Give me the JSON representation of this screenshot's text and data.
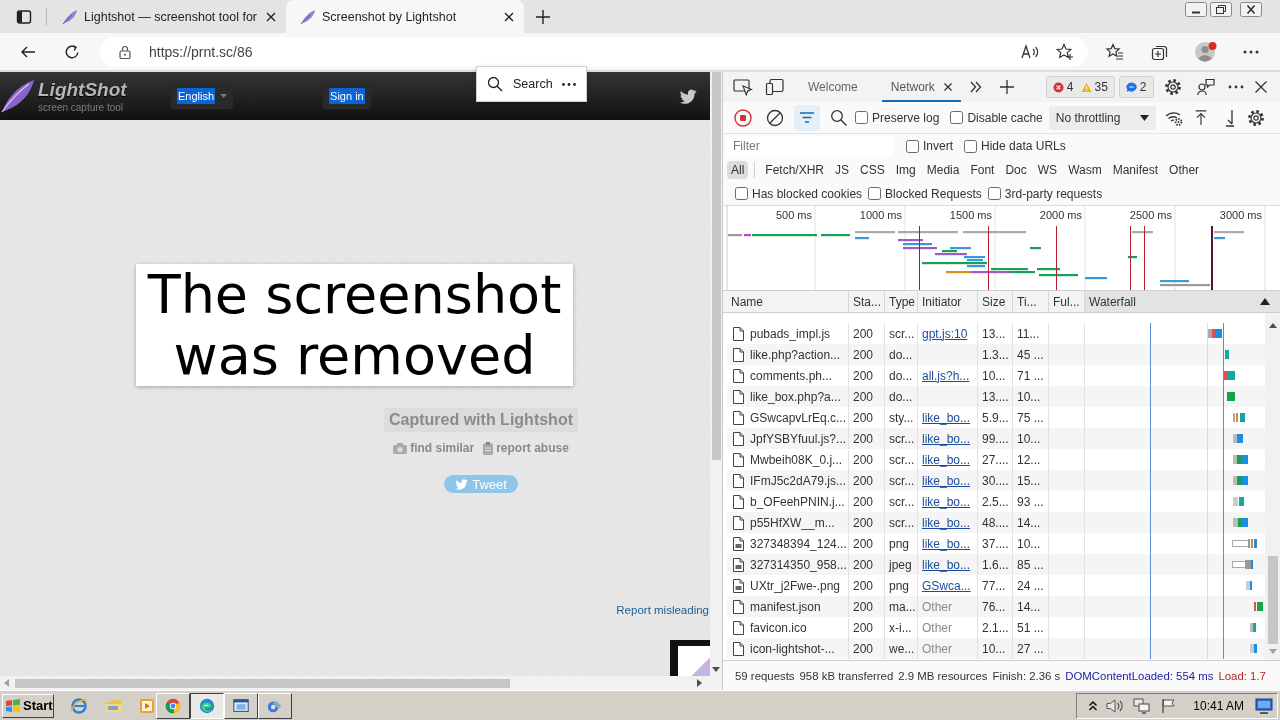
{
  "browser": {
    "tabs": [
      {
        "title": "Lightshot — screenshot tool for",
        "selected": false
      },
      {
        "title": "Screenshot by Lightshot",
        "selected": true
      }
    ],
    "url": "https://prnt.sc/86"
  },
  "page": {
    "header": {
      "logo_title": "LightShot",
      "logo_tagline": "screen capture tool",
      "language_button": "English",
      "sign_in_button": "Sign in"
    },
    "search_popup": {
      "label": "Search"
    },
    "notice": "The screenshot was removed",
    "captured_label": "Captured with Lightshot",
    "links": [
      {
        "label": "find similar",
        "kind": "camera"
      },
      {
        "label": "report abuse",
        "kind": "clipboard"
      }
    ],
    "tweet_button": "Tweet",
    "report_link": "Report misleading"
  },
  "devtools": {
    "tabs": [
      {
        "label": "Welcome",
        "selected": false
      },
      {
        "label": "Network",
        "selected": true
      }
    ],
    "console_badge": {
      "errors": "4",
      "warnings": "35"
    },
    "issues_badge": {
      "count": "2"
    },
    "toolbar": {
      "recording": true,
      "filter_on": true,
      "options": [
        {
          "label": "Preserve log",
          "checked": false
        },
        {
          "label": "Disable cache",
          "checked": false
        }
      ],
      "throttling": "No throttling"
    },
    "filter": {
      "placeholder": "Filter",
      "options": [
        {
          "label": "Invert",
          "checked": false
        },
        {
          "label": "Hide data URLs",
          "checked": false
        }
      ]
    },
    "type_filters": [
      {
        "label": "All",
        "selected": true
      },
      {
        "label": "Fetch/XHR",
        "selected": false
      },
      {
        "label": "JS",
        "selected": false
      },
      {
        "label": "CSS",
        "selected": false
      },
      {
        "label": "Img",
        "selected": false
      },
      {
        "label": "Media",
        "selected": false
      },
      {
        "label": "Font",
        "selected": false
      },
      {
        "label": "Doc",
        "selected": false
      },
      {
        "label": "WS",
        "selected": false
      },
      {
        "label": "Wasm",
        "selected": false
      },
      {
        "label": "Manifest",
        "selected": false
      },
      {
        "label": "Other",
        "selected": false
      }
    ],
    "blocked_options": [
      {
        "label": "Has blocked cookies",
        "checked": false
      },
      {
        "label": "Blocked Requests",
        "checked": false
      },
      {
        "label": "3rd-party requests",
        "checked": false
      }
    ],
    "overview_ticks": [
      "500 ms",
      "1000 ms",
      "1500 ms",
      "2000 ms",
      "2500 ms",
      "3000 ms"
    ],
    "columns": [
      {
        "label": "Name",
        "sorted": false
      },
      {
        "label": "Sta...",
        "sorted": false
      },
      {
        "label": "Type",
        "sorted": false
      },
      {
        "label": "Initiator",
        "sorted": false
      },
      {
        "label": "Size",
        "sorted": false
      },
      {
        "label": "Ti...",
        "sorted": false
      },
      {
        "label": "Ful...",
        "sorted": false
      },
      {
        "label": "Waterfall",
        "sorted": true
      }
    ],
    "rows": [
      {
        "kind": "file",
        "name": "pubads_impl.js",
        "status": "200",
        "type": "scr...",
        "initiator": "gpt.js:10",
        "initiator_link": true,
        "size": "13...",
        "time": "11..."
      },
      {
        "kind": "file",
        "name": "like.php?action...",
        "status": "200",
        "type": "do...",
        "size": "1.3...",
        "time": "45 ..."
      },
      {
        "kind": "file",
        "name": "comments.ph...",
        "status": "200",
        "type": "do...",
        "initiator": "all.js?h...",
        "initiator_link": true,
        "size": "10...",
        "time": "71 ..."
      },
      {
        "kind": "file",
        "name": "like_box.php?a...",
        "status": "200",
        "type": "do...",
        "size": "13....",
        "time": "10..."
      },
      {
        "kind": "file",
        "name": "GSwcapvLrEq.c...",
        "status": "200",
        "type": "sty...",
        "initiator": "like_bo...",
        "initiator_link": true,
        "size": "5.9...",
        "time": "75 ..."
      },
      {
        "kind": "file",
        "name": "JpfYSBYfuul.js?...",
        "status": "200",
        "type": "scr...",
        "initiator": "like_bo...",
        "initiator_link": true,
        "size": "99....",
        "time": "10..."
      },
      {
        "kind": "file",
        "name": "Mwbeih08K_0.j...",
        "status": "200",
        "type": "scr...",
        "initiator": "like_bo...",
        "initiator_link": true,
        "size": "27....",
        "time": "12..."
      },
      {
        "kind": "file",
        "name": "IFmJ5c2dA79.js...",
        "status": "200",
        "type": "scr...",
        "initiator": "like_bo...",
        "initiator_link": true,
        "size": "30....",
        "time": "15..."
      },
      {
        "kind": "file",
        "name": "b_OFeehPNIN.j...",
        "status": "200",
        "type": "scr...",
        "initiator": "like_bo...",
        "initiator_link": true,
        "size": "2.5...",
        "time": "93 ..."
      },
      {
        "kind": "file",
        "name": "p55HfXW__m...",
        "status": "200",
        "type": "scr...",
        "initiator": "like_bo...",
        "initiator_link": true,
        "size": "48....",
        "time": "14..."
      },
      {
        "kind": "image",
        "name": "327348394_124...",
        "status": "200",
        "type": "png",
        "initiator": "like_bo...",
        "initiator_link": true,
        "size": "37....",
        "time": "10..."
      },
      {
        "kind": "image",
        "name": "327314350_958...",
        "status": "200",
        "type": "jpeg",
        "initiator": "like_bo...",
        "initiator_link": true,
        "size": "1.6...",
        "time": "85 ..."
      },
      {
        "kind": "image",
        "name": "UXtr_j2Fwe-.png",
        "status": "200",
        "type": "png",
        "initiator": "GSwca...",
        "initiator_link": true,
        "size": "77...",
        "time": "24 ..."
      },
      {
        "kind": "file",
        "name": "manifest.json",
        "status": "200",
        "type": "ma...",
        "initiator": "Other",
        "initiator_link": false,
        "size": "76...",
        "time": "14..."
      },
      {
        "kind": "file",
        "name": "favicon.ico",
        "status": "200",
        "type": "x-i...",
        "initiator": "Other",
        "initiator_link": false,
        "size": "2.1...",
        "time": "51 ..."
      },
      {
        "kind": "file",
        "name": "icon-lightshot-...",
        "status": "200",
        "type": "we...",
        "initiator": "Other",
        "initiator_link": false,
        "size": "10...",
        "time": "27 ..."
      }
    ],
    "status": [
      {
        "text": "59 requests",
        "kind": "plain"
      },
      {
        "text": "958 kB transferred",
        "kind": "plain"
      },
      {
        "text": "2.9 MB resources",
        "kind": "plain"
      },
      {
        "text": "Finish: 2.36 s",
        "kind": "plain"
      },
      {
        "text": "DOMContentLoaded: 554 ms",
        "kind": "dom"
      },
      {
        "text": "Load: 1.7",
        "kind": "load"
      }
    ]
  },
  "taskbar": {
    "start": "Start",
    "tasks": [
      {
        "selected": false
      },
      {
        "selected": true
      },
      {
        "selected": false
      },
      {
        "selected": false
      }
    ],
    "clock": "10:41 AM"
  }
}
